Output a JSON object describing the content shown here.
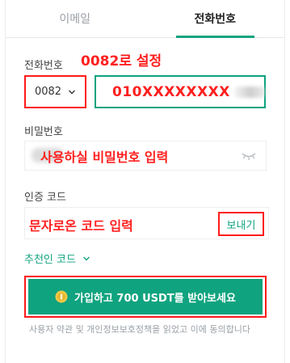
{
  "tabs": [
    {
      "label": "이메일",
      "active": false
    },
    {
      "label": "전화번호",
      "active": true
    }
  ],
  "phone_label": "전화번호",
  "annotations": {
    "country_note": "0082로 설정",
    "password_note": "사용하실 비밀번호 입력",
    "code_note": "문자로온 코드 입력"
  },
  "country_code": "0082",
  "phone_value": "010XXXXXXXX",
  "password_label": "비밀번호",
  "code_label": "인증 코드",
  "send_button": "보내기",
  "referral_label": "추천인 코드",
  "cta_label": "가입하고 700 USDT를 받아보세요",
  "terms_text": "사용자 약관 및 개인정보보호정책을 읽었고 이에 동의합니다",
  "colors": {
    "accent": "#10a37f",
    "annotation": "#ff1f1f",
    "muted": "#9aa0a6"
  },
  "icons": {
    "country_dropdown": "chevron-down-icon",
    "password_toggle": "eye-closed-icon",
    "referral_toggle": "chevron-down-icon",
    "cta": "coin-icon"
  }
}
